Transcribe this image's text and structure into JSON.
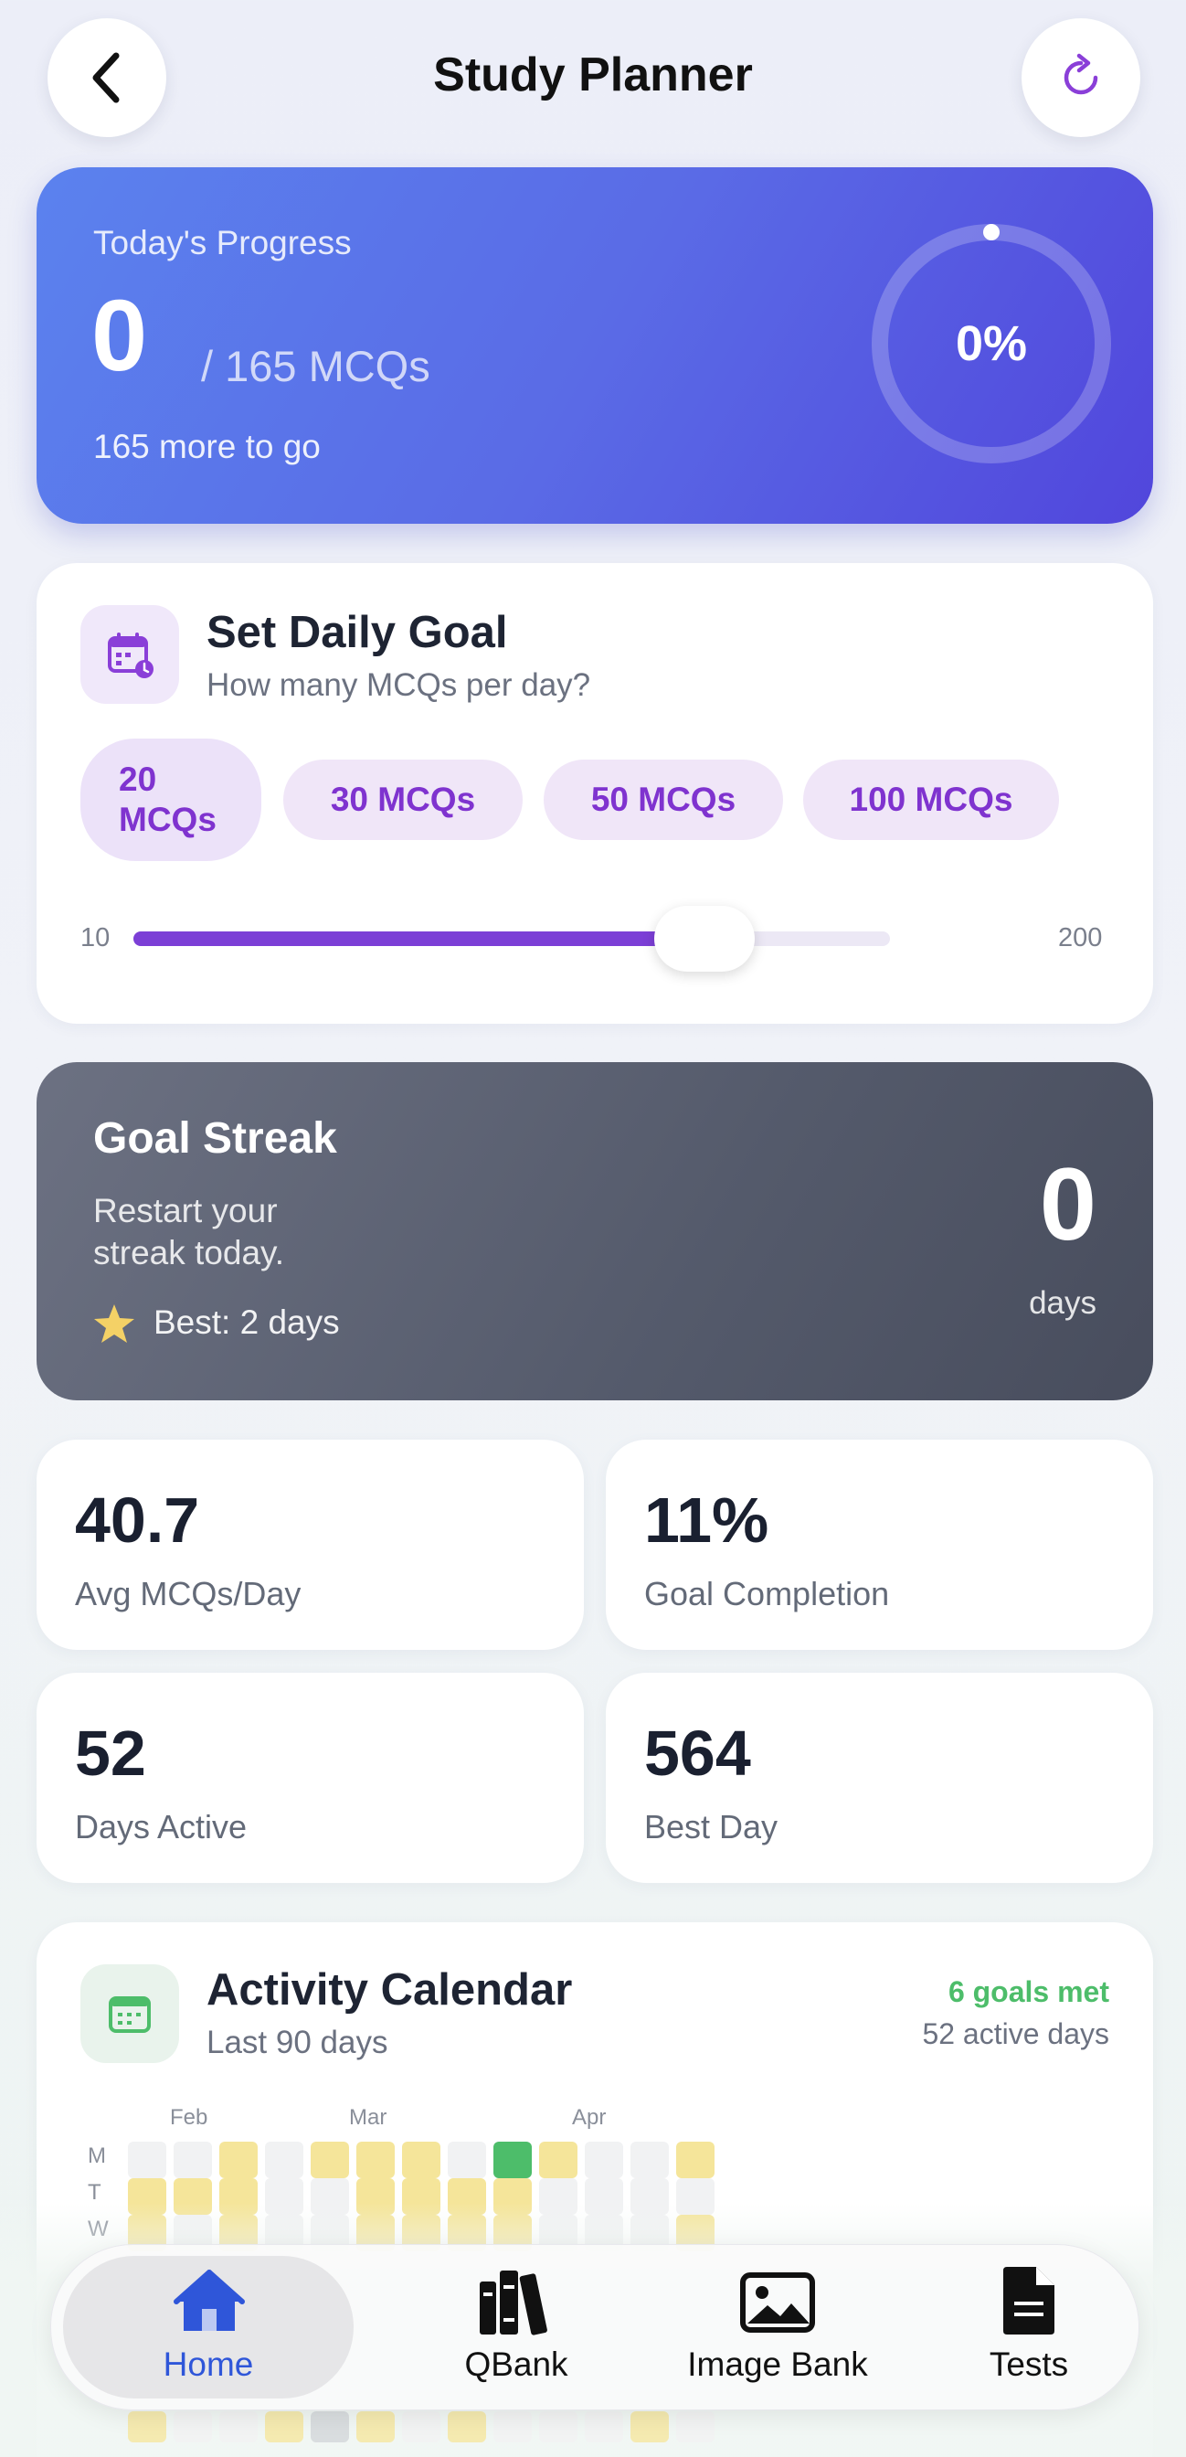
{
  "header": {
    "title": "Study Planner",
    "back_icon": "chevron-left-icon",
    "refresh_icon": "refresh-icon"
  },
  "progress": {
    "label": "Today's Progress",
    "done": "0",
    "total_text": "/ 165 MCQs",
    "remaining_text": "165 more to go",
    "percent_text": "0%",
    "percent_value": 0
  },
  "daily_goal": {
    "title": "Set Daily Goal",
    "subtitle": "How many MCQs per day?",
    "chips": [
      "20",
      "MCQs",
      "30 MCQs",
      "50 MCQs",
      "100 MCQs"
    ],
    "selected_chip_lines": [
      "20",
      "MCQs"
    ],
    "slider_min": "10",
    "slider_max": "200",
    "slider_value_fraction": 0.7
  },
  "streak": {
    "title": "Goal Streak",
    "message_line1": "Restart your",
    "message_line2": "streak today.",
    "best": "Best: 2 days",
    "count": "0",
    "unit": "days"
  },
  "stats": [
    {
      "value": "40.7",
      "label": "Avg MCQs/Day"
    },
    {
      "value": "11%",
      "label": "Goal Completion"
    },
    {
      "value": "52",
      "label": "Days Active"
    },
    {
      "value": "564",
      "label": "Best Day"
    }
  ],
  "calendar": {
    "title": "Activity Calendar",
    "subtitle": "Last 90 days",
    "goals_met": "6 goals met",
    "active_days": "52 active days",
    "months": [
      "Feb",
      "Mar",
      "Apr"
    ],
    "weekdays": [
      "M",
      "T",
      "W"
    ],
    "rows": [
      [
        "e",
        "e",
        "y",
        "e",
        "y",
        "y",
        "y",
        "e",
        "g",
        "y",
        "e",
        "e",
        "y"
      ],
      [
        "y",
        "y",
        "y",
        "e",
        "e",
        "y",
        "y",
        "y",
        "y",
        "e",
        "e",
        "e",
        "e"
      ],
      [
        "y",
        "e",
        "y",
        "e",
        "e",
        "y",
        "y",
        "y",
        "y",
        "e",
        "e",
        "e",
        "y"
      ]
    ],
    "hidden_row": [
      "y",
      "e",
      "e",
      "y",
      "s",
      "y",
      "e",
      "y",
      "e",
      "e",
      "e",
      "y",
      "e"
    ]
  },
  "colors": {
    "accent_purple": "#7f33cf",
    "active_blue": "#2f56d9",
    "goal_green": "#4dbd6a",
    "cell_yellow": "#f5e59a",
    "cell_empty": "#f1f2f3"
  },
  "nav": [
    {
      "label": "Home",
      "icon": "home-icon",
      "active": true
    },
    {
      "label": "QBank",
      "icon": "books-icon",
      "active": false
    },
    {
      "label": "Image Bank",
      "icon": "image-icon",
      "active": false
    },
    {
      "label": "Tests",
      "icon": "document-icon",
      "active": false
    }
  ]
}
